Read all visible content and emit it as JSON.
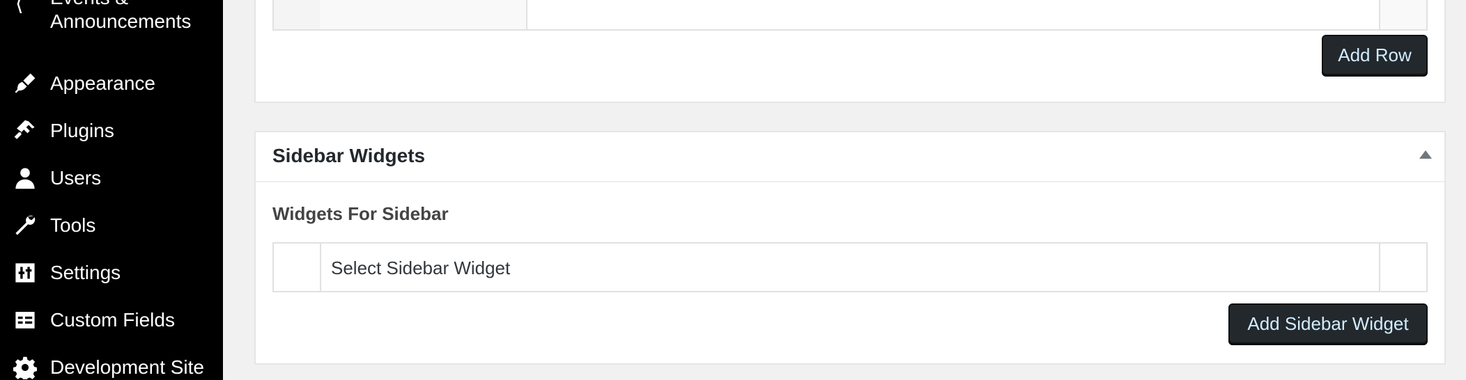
{
  "sidebar": {
    "partial_item": {
      "label_line1": "Events &",
      "label_line2": "Announcements",
      "icon": "megaphone-icon"
    },
    "items": [
      {
        "label": "Appearance",
        "icon": "paintbrush-icon"
      },
      {
        "label": "Plugins",
        "icon": "plugin-icon"
      },
      {
        "label": "Users",
        "icon": "user-icon"
      },
      {
        "label": "Tools",
        "icon": "wrench-icon"
      },
      {
        "label": "Settings",
        "icon": "sliders-icon"
      },
      {
        "label": "Custom Fields",
        "icon": "table-icon"
      },
      {
        "label": "Development Site",
        "icon": "gear-icon"
      }
    ]
  },
  "main": {
    "top_panel": {
      "add_row_label": "Add Row"
    },
    "widgets_panel": {
      "title": "Sidebar Widgets",
      "field_label": "Widgets For Sidebar",
      "select_placeholder": "Select Sidebar Widget",
      "add_button_label": "Add Sidebar Widget"
    }
  },
  "colors": {
    "sidebar_bg": "#000000",
    "button_bg": "#23282d",
    "button_text": "#d1ecff",
    "page_bg": "#f1f1f1"
  }
}
